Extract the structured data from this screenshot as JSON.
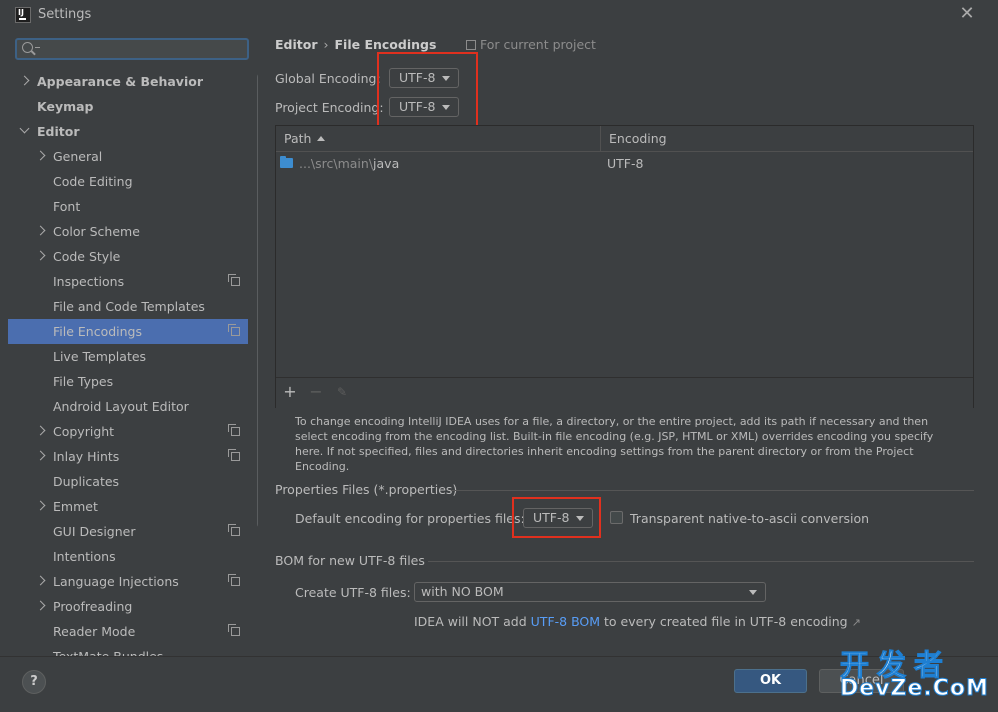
{
  "window": {
    "title": "Settings"
  },
  "sidebar": {
    "search_placeholder": "",
    "items": [
      {
        "label": "Appearance & Behavior",
        "bold": true,
        "expander": "right",
        "level": 0
      },
      {
        "label": "Keymap",
        "bold": true,
        "expander": "none",
        "level": 0
      },
      {
        "label": "Editor",
        "bold": true,
        "expander": "down",
        "level": 0
      },
      {
        "label": "General",
        "expander": "right",
        "level": 1
      },
      {
        "label": "Code Editing",
        "expander": "none",
        "level": 1
      },
      {
        "label": "Font",
        "expander": "none",
        "level": 1
      },
      {
        "label": "Color Scheme",
        "expander": "right",
        "level": 1
      },
      {
        "label": "Code Style",
        "expander": "right",
        "level": 1
      },
      {
        "label": "Inspections",
        "expander": "none",
        "level": 1,
        "project_icon": true
      },
      {
        "label": "File and Code Templates",
        "expander": "none",
        "level": 1
      },
      {
        "label": "File Encodings",
        "expander": "none",
        "level": 1,
        "project_icon": true,
        "selected": true
      },
      {
        "label": "Live Templates",
        "expander": "none",
        "level": 1
      },
      {
        "label": "File Types",
        "expander": "none",
        "level": 1
      },
      {
        "label": "Android Layout Editor",
        "expander": "none",
        "level": 1
      },
      {
        "label": "Copyright",
        "expander": "right",
        "level": 1,
        "project_icon": true
      },
      {
        "label": "Inlay Hints",
        "expander": "right",
        "level": 1,
        "project_icon": true
      },
      {
        "label": "Duplicates",
        "expander": "none",
        "level": 1
      },
      {
        "label": "Emmet",
        "expander": "right",
        "level": 1
      },
      {
        "label": "GUI Designer",
        "expander": "none",
        "level": 1,
        "project_icon": true
      },
      {
        "label": "Intentions",
        "expander": "none",
        "level": 1
      },
      {
        "label": "Language Injections",
        "expander": "right",
        "level": 1,
        "project_icon": true
      },
      {
        "label": "Proofreading",
        "expander": "right",
        "level": 1
      },
      {
        "label": "Reader Mode",
        "expander": "none",
        "level": 1,
        "project_icon": true
      },
      {
        "label": "TextMate Bundles",
        "expander": "none",
        "level": 1
      }
    ]
  },
  "content": {
    "breadcrumb": {
      "parent": "Editor",
      "separator": "›",
      "current": "File Encodings"
    },
    "for_project": "For current project",
    "global_encoding": {
      "label": "Global Encoding:",
      "value": "UTF-8"
    },
    "project_encoding": {
      "label": "Project Encoding:",
      "value": "UTF-8"
    },
    "table": {
      "columns": [
        "Path",
        "Encoding"
      ],
      "rows": [
        {
          "path_prefix": "...\\src\\main\\",
          "path_name": "java",
          "encoding": "UTF-8"
        }
      ]
    },
    "help_text": "To change encoding IntelliJ IDEA uses for a file, a directory, or the entire project, add its path if necessary and then select encoding from the encoding list. Built-in file encoding (e.g. JSP, HTML or XML) overrides encoding you specify here. If not specified, files and directories inherit encoding settings from the parent directory or from the Project Encoding.",
    "properties": {
      "section_title": "Properties Files (*.properties)",
      "default_label": "Default encoding for properties files:",
      "default_value": "UTF-8",
      "transparent_label": "Transparent native-to-ascii conversion",
      "transparent_checked": false
    },
    "bom": {
      "section_title": "BOM for new UTF-8 files",
      "create_label": "Create UTF-8 files:",
      "create_value": "with NO BOM",
      "note_prefix": "IDEA will NOT add ",
      "note_link": "UTF-8 BOM",
      "note_suffix": " to every created file in UTF-8 encoding",
      "note_arrow": "↗"
    }
  },
  "footer": {
    "help": "?",
    "ok": "OK",
    "cancel": "Cancel"
  },
  "watermark": {
    "top": "开发者",
    "bottom": "DevZe.CoM"
  },
  "colors": {
    "accent_selection": "#4b6eaf",
    "highlight_box": "#e0301e",
    "link": "#589df6"
  }
}
